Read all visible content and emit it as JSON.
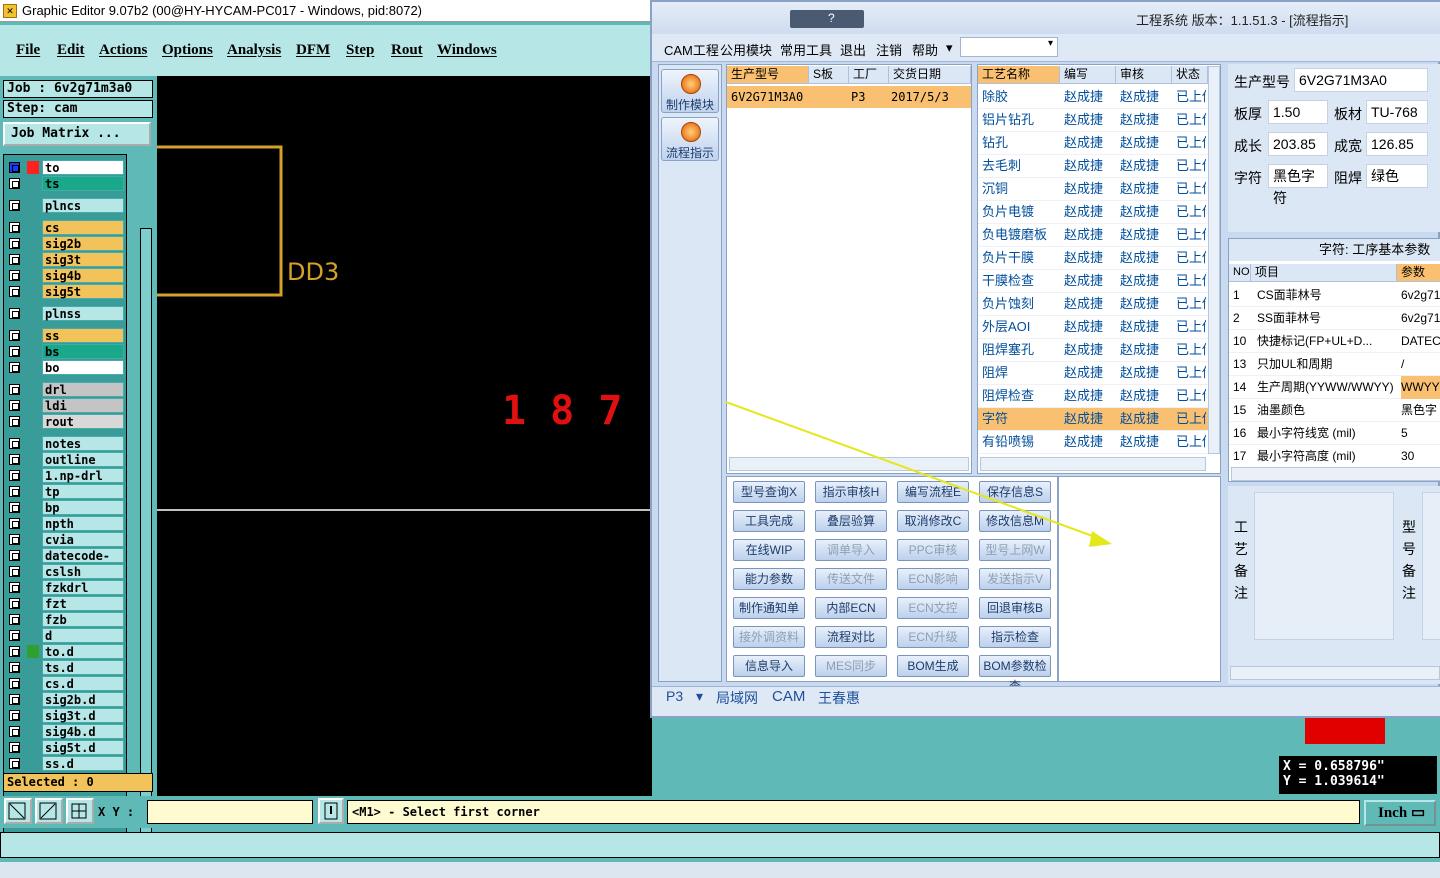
{
  "main_window": {
    "title": "Graphic Editor 9.07b2 (00@HY-HYCAM-PC017 - Windows, pid:8072)",
    "menu": [
      "File",
      "Edit",
      "Actions",
      "Options",
      "Analysis",
      "DFM",
      "Step",
      "Rout",
      "Windows"
    ]
  },
  "left": {
    "job_label": "Job : 6v2g71m3a0",
    "step_label": "Step: cam",
    "job_matrix": "Job Matrix ...",
    "selected": "Selected : 0",
    "layers": [
      {
        "name": "to",
        "color": "#ffffff",
        "mark": "#ff2020"
      },
      {
        "name": "ts",
        "color": "#1aa88a",
        "mark": ""
      },
      {
        "name": "plncs",
        "color": "#b7e6e6",
        "mark": ""
      },
      {
        "name": "cs",
        "color": "#f2c35a",
        "mark": ""
      },
      {
        "name": "sig2b",
        "color": "#f2c35a",
        "mark": ""
      },
      {
        "name": "sig3t",
        "color": "#f2c35a",
        "mark": ""
      },
      {
        "name": "sig4b",
        "color": "#f2c35a",
        "mark": ""
      },
      {
        "name": "sig5t",
        "color": "#f2c35a",
        "mark": ""
      },
      {
        "name": "plnss",
        "color": "#b7e6e6",
        "mark": ""
      },
      {
        "name": "ss",
        "color": "#f2c35a",
        "mark": ""
      },
      {
        "name": "bs",
        "color": "#1aa88a",
        "mark": ""
      },
      {
        "name": "bo",
        "color": "#ffffff",
        "mark": ""
      },
      {
        "name": "drl",
        "color": "#c4c4c4",
        "mark": ""
      },
      {
        "name": "ldi",
        "color": "#c4c4c4",
        "mark": ""
      },
      {
        "name": "rout",
        "color": "#d8d8d8",
        "mark": ""
      },
      {
        "name": "notes",
        "color": "#b7e6e6",
        "mark": ""
      },
      {
        "name": "outline",
        "color": "#b7e6e6",
        "mark": ""
      },
      {
        "name": "1.np-drl",
        "color": "#b7e6e6",
        "mark": ""
      },
      {
        "name": "tp",
        "color": "#b7e6e6",
        "mark": ""
      },
      {
        "name": "bp",
        "color": "#b7e6e6",
        "mark": ""
      },
      {
        "name": "npth",
        "color": "#b7e6e6",
        "mark": ""
      },
      {
        "name": "cvia",
        "color": "#b7e6e6",
        "mark": ""
      },
      {
        "name": "datecode-to",
        "color": "#b7e6e6",
        "mark": ""
      },
      {
        "name": "cslsh",
        "color": "#b7e6e6",
        "mark": ""
      },
      {
        "name": "fzkdrl",
        "color": "#b7e6e6",
        "mark": ""
      },
      {
        "name": "fzt",
        "color": "#b7e6e6",
        "mark": ""
      },
      {
        "name": "fzb",
        "color": "#b7e6e6",
        "mark": ""
      },
      {
        "name": "d",
        "color": "#b7e6e6",
        "mark": ""
      },
      {
        "name": "to.d",
        "color": "#b7e6e6",
        "mark": "#2fa02f"
      },
      {
        "name": "ts.d",
        "color": "#b7e6e6",
        "mark": ""
      },
      {
        "name": "cs.d",
        "color": "#b7e6e6",
        "mark": ""
      },
      {
        "name": "sig2b.d",
        "color": "#b7e6e6",
        "mark": ""
      },
      {
        "name": "sig3t.d",
        "color": "#b7e6e6",
        "mark": ""
      },
      {
        "name": "sig4b.d",
        "color": "#b7e6e6",
        "mark": ""
      },
      {
        "name": "sig5t.d",
        "color": "#b7e6e6",
        "mark": ""
      },
      {
        "name": "ss.d",
        "color": "#b7e6e6",
        "mark": ""
      }
    ]
  },
  "canvas": {
    "label": "DD3",
    "digits": "1 8 7"
  },
  "status": {
    "xy_label": "X Y :",
    "message": "<M1> - Select first corner",
    "units": "Inch",
    "x": "X = 0.658796\"",
    "y": "Y = 1.039614\""
  },
  "popup": {
    "title": "工程系统  版本：1.1.51.3 - [流程指示]",
    "menu": [
      "CAM工程",
      "公用模块",
      "常用工具",
      "退出",
      "注销",
      "帮助"
    ],
    "side_buttons": [
      "制作模块",
      "流程指示"
    ],
    "model_table": {
      "headers": [
        "生产型号",
        "S板",
        "工厂",
        "交货日期"
      ],
      "row": [
        "6V2G71M3A0",
        "",
        "P3",
        "2017/5/3"
      ]
    },
    "process_table": {
      "headers": [
        "工艺名称",
        "编写",
        "审核",
        "状态"
      ],
      "rows": [
        [
          "除胶",
          "赵成捷",
          "赵成捷",
          "已上传"
        ],
        [
          "铝片钻孔",
          "赵成捷",
          "赵成捷",
          "已上传"
        ],
        [
          "钻孔",
          "赵成捷",
          "赵成捷",
          "已上传"
        ],
        [
          "去毛刺",
          "赵成捷",
          "赵成捷",
          "已上传"
        ],
        [
          "沉铜",
          "赵成捷",
          "赵成捷",
          "已上传"
        ],
        [
          "负片电镀",
          "赵成捷",
          "赵成捷",
          "已上传"
        ],
        [
          "负电镀磨板",
          "赵成捷",
          "赵成捷",
          "已上传"
        ],
        [
          "负片干膜",
          "赵成捷",
          "赵成捷",
          "已上传"
        ],
        [
          "干膜检查",
          "赵成捷",
          "赵成捷",
          "已上传"
        ],
        [
          "负片蚀刻",
          "赵成捷",
          "赵成捷",
          "已上传"
        ],
        [
          "外层AOI",
          "赵成捷",
          "赵成捷",
          "已上传"
        ],
        [
          "阻焊塞孔",
          "赵成捷",
          "赵成捷",
          "已上传"
        ],
        [
          "阻焊",
          "赵成捷",
          "赵成捷",
          "已上传"
        ],
        [
          "阻焊检查",
          "赵成捷",
          "赵成捷",
          "已上传"
        ],
        [
          "字符",
          "赵成捷",
          "赵成捷",
          "已上传"
        ],
        [
          "有铅喷锡",
          "赵成捷",
          "赵成捷",
          "已上传"
        ]
      ]
    },
    "buttons": [
      [
        "型号查询X",
        "指示审核H",
        "编写流程E",
        "保存信息S"
      ],
      [
        "工具完成",
        "叠层验算",
        "取消修改C",
        "修改信息M"
      ],
      [
        "在线WIP",
        "调单导入",
        "PPC审核",
        "型号上网W"
      ],
      [
        "能力参数",
        "传送文件",
        "ECN影响",
        "发送指示V"
      ],
      [
        "制作通知单",
        "内部ECN",
        "ECN文控",
        "回退审核B"
      ],
      [
        "接外调资料",
        "流程对比",
        "ECN升级",
        "指示检查"
      ],
      [
        "信息导入",
        "MES同步",
        "BOM生成",
        "BOM参数检查"
      ]
    ],
    "disabled": [
      "调单导入",
      "PPC审核",
      "型号上网W",
      "传送文件",
      "ECN影响",
      "发送指示V",
      "ECN文控",
      "接外调资料",
      "ECN升级",
      "MES同步"
    ],
    "info": {
      "model_label": "生产型号",
      "model": "6V2G71M3A0",
      "thick_label": "板厚",
      "thick": "1.50",
      "mat_label": "板材",
      "mat": "TU-768",
      "len_label": "成长",
      "len": "203.85",
      "wid_label": "成宽",
      "wid": "126.85",
      "char_label": "字符",
      "char": "黑色字符",
      "mask_label": "阻焊",
      "mask": "绿色"
    },
    "param_title": "字符: 工序基本参数",
    "param_headers": [
      "NO",
      "项目",
      "参数"
    ],
    "params": [
      [
        "1",
        "CS面菲林号",
        "6v2g71"
      ],
      [
        "2",
        "SS面菲林号",
        "6v2g71"
      ],
      [
        "10",
        "快捷标记(FP+UL+D...",
        "DATECO"
      ],
      [
        "13",
        "只加UL和周期",
        "/"
      ],
      [
        "14",
        "生产周期(YYWW/WWYY)",
        "WWYY"
      ],
      [
        "15",
        "油墨颜色",
        "黑色字"
      ],
      [
        "16",
        "最小字符线宽 (mil)",
        "5"
      ],
      [
        "17",
        "最小字符高度 (mil)",
        "30"
      ]
    ],
    "remark1": "工艺备注",
    "remark2": "型号备注",
    "tabs": [
      "P3",
      "局域网",
      "CAM",
      "王春惠"
    ]
  }
}
